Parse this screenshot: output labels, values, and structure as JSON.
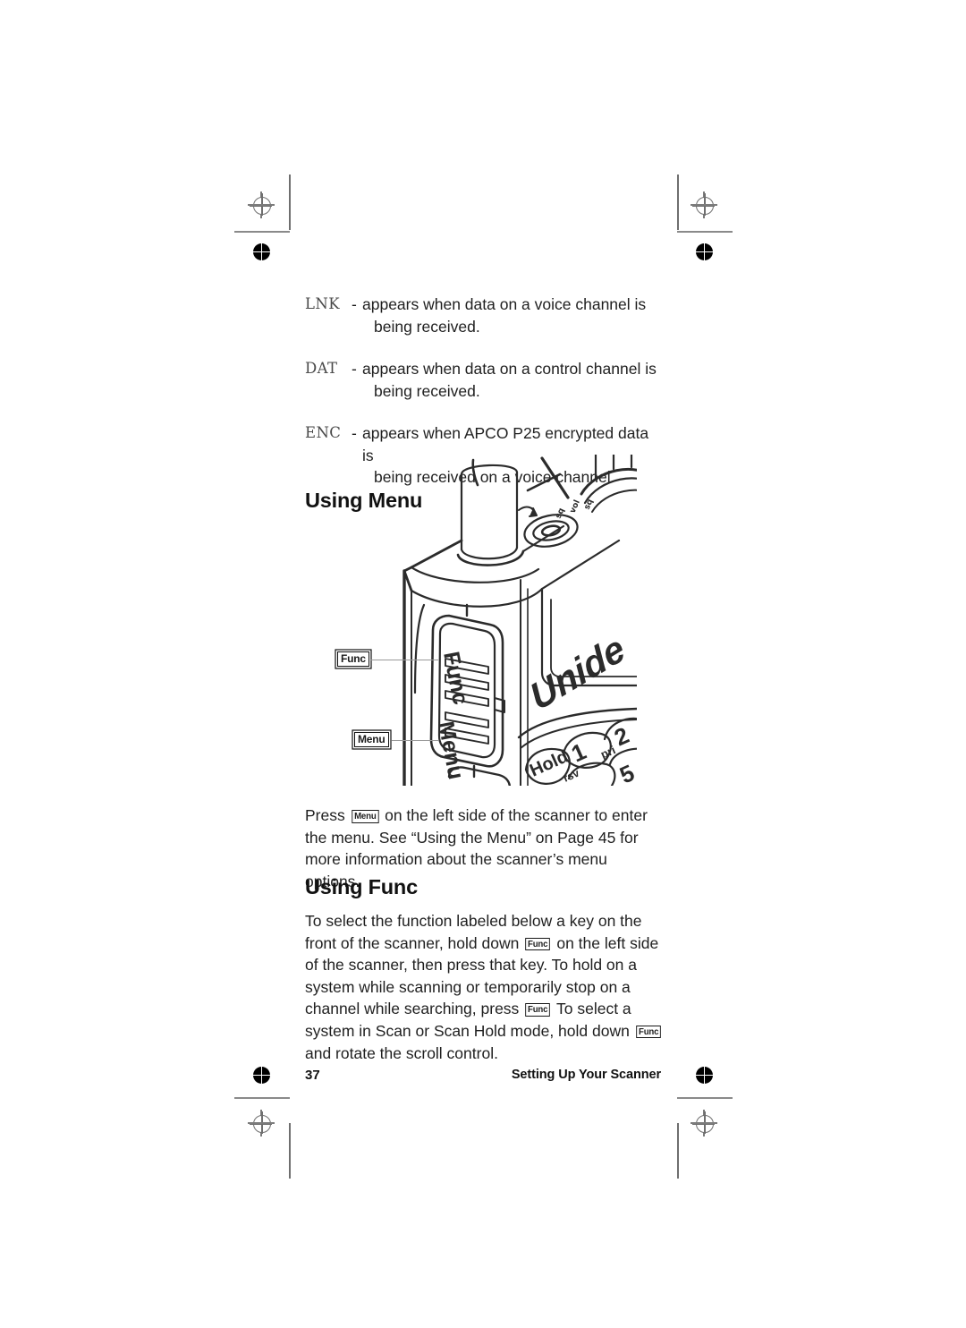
{
  "page": {
    "number": "37",
    "running_title": "Setting Up Your Scanner"
  },
  "indicators": [
    {
      "term": "LNK",
      "dash": "-",
      "description": "appears when data on a voice channel is",
      "description_cont": "being received."
    },
    {
      "term": "DAT",
      "dash": "-",
      "description": "appears when data on a control channel is",
      "description_cont": "being received."
    },
    {
      "term": "ENC",
      "dash": "-",
      "description": "appears when APCO P25 encrypted data is",
      "description_cont": "being received on a voice channel."
    }
  ],
  "sections": {
    "using_menu": {
      "heading": "Using Menu",
      "paragraph": {
        "part1": "Press ",
        "key1": "Menu",
        "part2": " on the left side of the scanner to enter the menu. See “Using the Menu” on Page 45 for more information about the scanner’s menu options."
      }
    },
    "using_func": {
      "heading": "Using Func",
      "paragraph": {
        "part1": "To select the function labeled below a key on the front of the scanner, hold down ",
        "key1": "Func",
        "part2": " on the left side of the scanner, then press that key. To hold on a system while scanning or temporarily stop on a channel while searching, press ",
        "key2": "Func",
        "part3": " To select a system in Scan or Scan Hold mode, hold down ",
        "key3": "Func",
        "part4": " and rotate the scroll control."
      }
    }
  },
  "illustration": {
    "alt": "Isometric line drawing of handheld scanner left side showing Func and Menu side keys",
    "callouts": [
      {
        "label": "Func"
      },
      {
        "label": "Menu"
      }
    ],
    "device_labels": {
      "side_key_top": "Func",
      "side_key_bottom": "Menu",
      "brand": "Unide",
      "keypad": [
        "Hold",
        "1",
        "pri",
        "2",
        "5"
      ]
    }
  }
}
